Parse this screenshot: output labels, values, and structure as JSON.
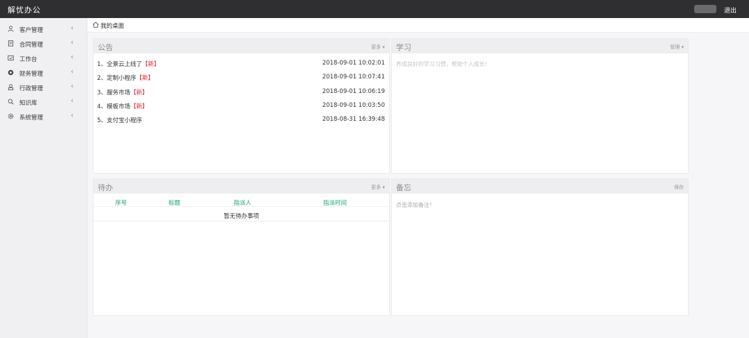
{
  "app": {
    "title": "解忧办公",
    "logout": "退出"
  },
  "sidebar": {
    "items": [
      {
        "label": "客户管理",
        "icon": "user-icon"
      },
      {
        "label": "合同管理",
        "icon": "contract-icon"
      },
      {
        "label": "工作台",
        "icon": "workbench-icon"
      },
      {
        "label": "财务管理",
        "icon": "finance-icon"
      },
      {
        "label": "行政管理",
        "icon": "admin-icon"
      },
      {
        "label": "知识库",
        "icon": "search-icon"
      },
      {
        "label": "系统管理",
        "icon": "gear-icon"
      }
    ]
  },
  "breadcrumb": {
    "label": "我的桌面"
  },
  "notice": {
    "title": "公告",
    "more": "更多",
    "items": [
      {
        "title": "1、全景云上线了",
        "tag": "【新】",
        "time": "2018-09-01 10:02:01"
      },
      {
        "title": "2、定制小程序",
        "tag": "【新】",
        "time": "2018-09-01 10:07:41"
      },
      {
        "title": "3、服务市场",
        "tag": "【新】",
        "time": "2018-09-01 10:06:19"
      },
      {
        "title": "4、模板市场",
        "tag": "【新】",
        "time": "2018-09-01 10:03:50"
      },
      {
        "title": "5、支付宝小程序",
        "tag": "",
        "time": "2018-08-31 16:39:48"
      }
    ]
  },
  "study": {
    "title": "学习",
    "manage": "管理",
    "hint": "养成良好的学习习惯，帮助个人成长！"
  },
  "todo": {
    "title": "待办",
    "more": "更多",
    "columns": [
      "序号",
      "标题",
      "指派人",
      "指派时间"
    ],
    "empty": "暂无待办事项"
  },
  "memo": {
    "title": "备忘",
    "save": "保存",
    "placeholder": "点击添加备注！"
  },
  "colors": {
    "topbar": "#2f2f31",
    "new_tag": "#d9232d",
    "todo_header": "#1e9e7a"
  }
}
